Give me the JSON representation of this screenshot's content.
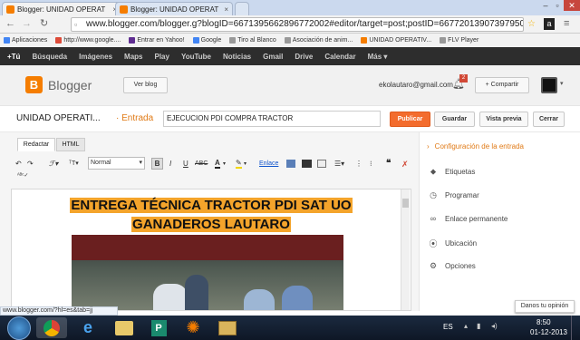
{
  "browser": {
    "tabs": [
      {
        "title": "Blogger: UNIDAD OPERAT",
        "close": "×"
      },
      {
        "title": "Blogger: UNIDAD OPERAT",
        "close": "×"
      }
    ],
    "url": "www.blogger.com/blogger.g?blogID=6671395662896772002#editor/target=post;postID=66772013907397950",
    "bookmarks": [
      {
        "label": "Aplicaciones",
        "color": "#4285f4"
      },
      {
        "label": "http://www.google....",
        "color": "#dd4b39"
      },
      {
        "label": "Entrar en Yahoo!",
        "color": "#5f2d91"
      },
      {
        "label": "Google",
        "color": "#4285f4"
      },
      {
        "label": "Tiro al Blanco",
        "color": "#999999"
      },
      {
        "label": "Asociación de anim...",
        "color": "#999999"
      },
      {
        "label": "UNIDAD OPERATIV...",
        "color": "#f57d00"
      },
      {
        "label": "FLV Player",
        "color": "#999999"
      }
    ]
  },
  "google_bar": {
    "items": [
      "+Tú",
      "Búsqueda",
      "Imágenes",
      "Maps",
      "Play",
      "YouTube",
      "Noticias",
      "Gmail",
      "Drive",
      "Calendar",
      "Más"
    ]
  },
  "blogger": {
    "logo_text": "Blogger",
    "view_blog": "Ver blog",
    "user_email": "ekolautaro@gmail.com",
    "notifications": "2",
    "share": "+ Compartir",
    "blog_name": "UNIDAD OPERATI...",
    "section": "· Entrada",
    "post_title": "EJECUCION PDI COMPRA TRACTOR",
    "publish": "Publicar",
    "save": "Guardar",
    "preview": "Vista previa",
    "close": "Cerrar"
  },
  "editor": {
    "tab_compose": "Redactar",
    "tab_html": "HTML",
    "font_size": "Normal",
    "link_label": "Enlace",
    "heading_line1": "ENTREGA TÉCNICA TRACTOR PDI SAT UO",
    "heading_line2": "GANADEROS LAUTARO"
  },
  "settings_sidebar": {
    "title": "Configuración de la entrada",
    "items": [
      {
        "label": "Etiquetas",
        "icon": "tag-icon"
      },
      {
        "label": "Programar",
        "icon": "clock-icon"
      },
      {
        "label": "Enlace permanente",
        "icon": "link-icon"
      },
      {
        "label": "Ubicación",
        "icon": "location-icon"
      },
      {
        "label": "Opciones",
        "icon": "gear-icon"
      }
    ]
  },
  "status_bar": "www.blogger.com/?hl=es&tab=jj",
  "feedback": "Danos tu opinión",
  "taskbar": {
    "lang": "ES",
    "time": "8:50",
    "date": "01-12-2013"
  },
  "colors": {
    "accent_orange": "#f57d00",
    "publish_orange": "#f36c2d",
    "highlight": "#f4a42b",
    "google_bar": "#2d2d2d"
  }
}
